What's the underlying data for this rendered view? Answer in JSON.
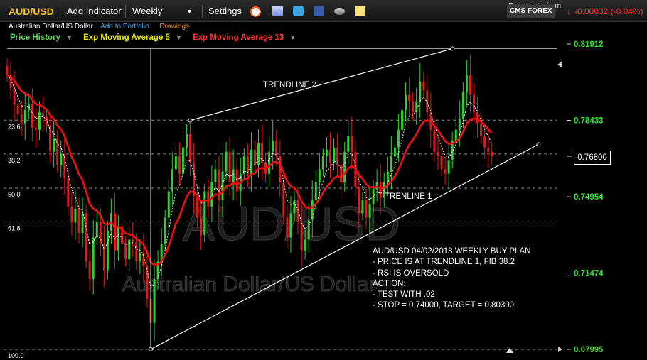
{
  "toolbar": {
    "symbol": "AUD/USD",
    "add_indicator": "Add Indicator",
    "period": "Weekly",
    "settings": "Settings",
    "forex_label": "Forex data from",
    "provider": "CMS FOREX",
    "change": "-0.00032 (-0.04%)",
    "change_color": "#ff2b2b"
  },
  "subheader": {
    "instrument": "Australian Dollar/US Dollar",
    "add_portfolio": "Add to Portfolio",
    "drawings": "Drawings",
    "price_history": "Price History",
    "ema5": "Exp Moving Average 5",
    "ema13": "Exp Moving Average 13"
  },
  "watermark": {
    "symbol": "AUD/USD",
    "name": "Australian Dollar/US Dollar"
  },
  "note": {
    "lines": [
      "AUD/USD 04/02/2018 WEEKLY BUY PLAN",
      "- PRICE IS AT TRENDLINE 1, FIB 38.2",
      "- RSI IS OVERSOLD",
      "ACTION:",
      "- TEST WITH .02",
      "- STOP = 0.74000, TARGET = 0.80300"
    ]
  },
  "colors": {
    "up": "#2fd12f",
    "down": "#e11b1b",
    "ema13": "#ee1111",
    "axis_label": "#34e034",
    "price_history": "#5cd65c",
    "ema5": "#e6e600",
    "ema13_label": "#ff3333",
    "portfolio": "#4aa3e0",
    "drawings": "#e08a2a"
  },
  "chart_data": {
    "type": "candlestick",
    "ylim": [
      0.67995,
      0.81912
    ],
    "y_ticks": [
      "0.81912",
      "0.78433",
      "0.74954",
      "0.71474",
      "0.67995"
    ],
    "last_price": "0.76800",
    "fib_levels": [
      {
        "label": "23.6",
        "value": 0.7844
      },
      {
        "label": "38.2",
        "value": 0.769
      },
      {
        "label": "50.0",
        "value": 0.7534
      },
      {
        "label": "61.8",
        "value": 0.7381
      },
      {
        "label": "100.0",
        "value": 0.6799
      }
    ],
    "trendlines": [
      {
        "label": "TRENDLINE 2",
        "from": [
          51,
          0.7843
        ],
        "to": [
          124,
          0.817
        ]
      },
      {
        "label": "TRENLINE 1",
        "from": [
          40,
          0.68
        ],
        "to": [
          148,
          0.7734
        ]
      }
    ],
    "vertical_marker_index": 40,
    "closes": [
      0.805,
      0.799,
      0.7915,
      0.787,
      0.783,
      0.789,
      0.792,
      0.781,
      0.78,
      0.788,
      0.786,
      0.782,
      0.77,
      0.776,
      0.764,
      0.769,
      0.758,
      0.745,
      0.738,
      0.744,
      0.733,
      0.742,
      0.72,
      0.712,
      0.731,
      0.738,
      0.728,
      0.716,
      0.734,
      0.742,
      0.725,
      0.736,
      0.728,
      0.721,
      0.73,
      0.729,
      0.72,
      0.724,
      0.718,
      0.703,
      0.692,
      0.712,
      0.72,
      0.728,
      0.74,
      0.752,
      0.762,
      0.768,
      0.76,
      0.772,
      0.778,
      0.765,
      0.75,
      0.74,
      0.732,
      0.752,
      0.745,
      0.756,
      0.762,
      0.748,
      0.761,
      0.77,
      0.756,
      0.762,
      0.752,
      0.76,
      0.768,
      0.759,
      0.771,
      0.764,
      0.774,
      0.765,
      0.76,
      0.77,
      0.775,
      0.768,
      0.756,
      0.74,
      0.731,
      0.742,
      0.748,
      0.738,
      0.725,
      0.73,
      0.739,
      0.748,
      0.756,
      0.762,
      0.768,
      0.771,
      0.765,
      0.772,
      0.764,
      0.756,
      0.77,
      0.777,
      0.77,
      0.754,
      0.742,
      0.748,
      0.74,
      0.746,
      0.753,
      0.756,
      0.749,
      0.756,
      0.761,
      0.768,
      0.772,
      0.78,
      0.789,
      0.796,
      0.793,
      0.788,
      0.793,
      0.802,
      0.798,
      0.788,
      0.78,
      0.77,
      0.768,
      0.762,
      0.76,
      0.766,
      0.775,
      0.78,
      0.785,
      0.797,
      0.805,
      0.796,
      0.788,
      0.783,
      0.777,
      0.772,
      0.77,
      0.768
    ]
  }
}
